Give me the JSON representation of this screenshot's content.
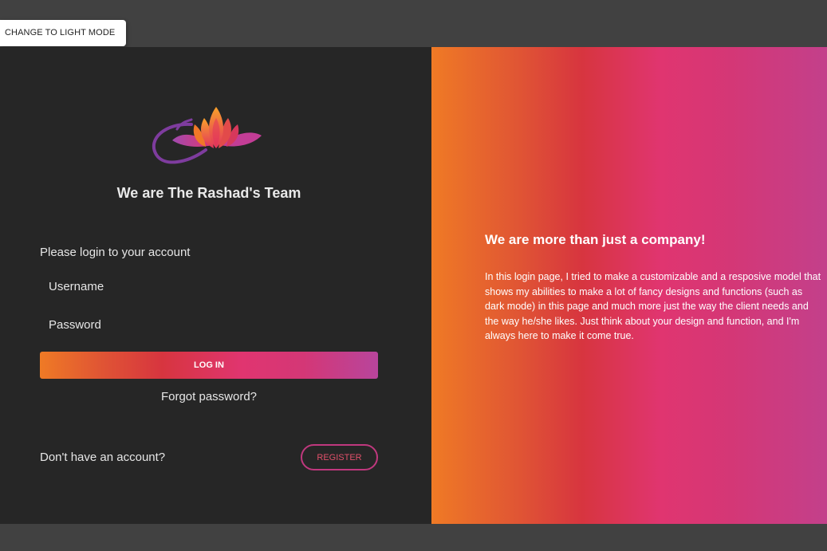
{
  "mode_toggle": {
    "label": "CHANGE TO LIGHT MODE"
  },
  "logo": {
    "icon": "lotus-logo-icon",
    "colors": [
      "#ef7a25",
      "#e03570",
      "#8a3fa0"
    ]
  },
  "left_panel": {
    "team_title": "We are The Rashad's Team",
    "login_prompt": "Please login to your account",
    "username_placeholder": "Username",
    "password_placeholder": "Password",
    "login_label": "LOG IN",
    "forgot_label": "Forgot password?",
    "no_account_label": "Don't have an account?",
    "register_label": "REGISTER"
  },
  "right_panel": {
    "title": "We are more than just a company!",
    "description": "In this login page, I tried to make a customizable and a resposive model that shows my abilities to make a lot of fancy designs and functions (such as dark mode) in this page and much more just the way the client needs and the way he/she likes. Just think about your design and function, and I'm always here to make it come true."
  },
  "colors": {
    "page_background": "#414141",
    "card_dark": "#262626",
    "gradient": [
      "#ef7a25",
      "#d7353f",
      "#e03570",
      "#c3408b"
    ],
    "register_border": "#c0387e"
  }
}
